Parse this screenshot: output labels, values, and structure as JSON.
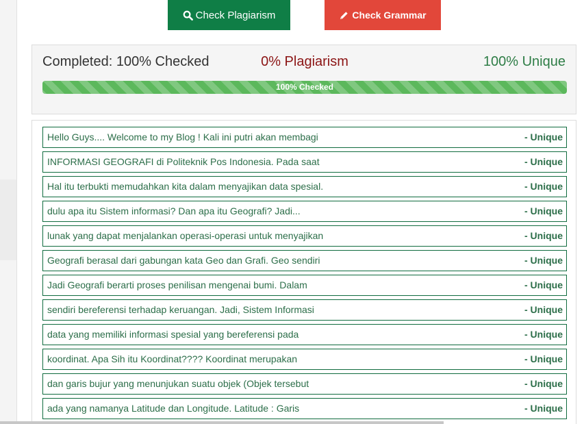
{
  "buttons": {
    "check_plagiarism": "Check Plagiarism",
    "check_grammar": "Check Grammar"
  },
  "summary": {
    "completed": "Completed: 100% Checked",
    "plagiarism": "0% Plagiarism",
    "unique": "100% Unique"
  },
  "progress": {
    "percent": 100,
    "label": "100% Checked"
  },
  "results": [
    {
      "text": "Hello Guys.... Welcome to my Blog ! Kali ini putri akan membagi",
      "status": "- Unique"
    },
    {
      "text": "INFORMASI GEOGRAFI di Politeknik Pos Indonesia. Pada saat",
      "status": "- Unique"
    },
    {
      "text": "Hal itu terbukti memudahkan kita dalam menyajikan data spesial.",
      "status": "- Unique"
    },
    {
      "text": "dulu apa itu Sistem informasi? Dan apa itu Geografi? Jadi...",
      "status": "- Unique"
    },
    {
      "text": "lunak yang dapat menjalankan operasi-operasi untuk menyajikan",
      "status": "- Unique"
    },
    {
      "text": "Geografi berasal dari gabungan kata Geo dan Grafi. Geo sendiri",
      "status": "- Unique"
    },
    {
      "text": "Jadi Geografi berarti proses penilisan mengenai bumi. Dalam",
      "status": "- Unique"
    },
    {
      "text": "sendiri bereferensi terhadap keruangan. Jadi, Sistem Informasi",
      "status": "- Unique"
    },
    {
      "text": "data yang memiliki informasi spesial yang bereferensi pada",
      "status": "- Unique"
    },
    {
      "text": "koordinat. Apa Sih itu Koordinat???? Koordinat merupakan",
      "status": "- Unique"
    },
    {
      "text": "dan garis bujur yang menunjukan suatu objek (Objek tersebut",
      "status": "- Unique"
    },
    {
      "text": "ada yang namanya Latitude dan Longitude. Latitude : Garis",
      "status": "- Unique"
    }
  ],
  "icons": {
    "check_plagiarism": "search-icon",
    "check_grammar": "pencil-icon"
  },
  "colors": {
    "plagiarism_button": "#0f7e46",
    "grammar_button": "#e2473a",
    "plagiarism_text": "#8b1414",
    "unique_text": "#2e7d46",
    "progress_bar": "#5cb85c",
    "row_border": "#0f6b3e"
  }
}
